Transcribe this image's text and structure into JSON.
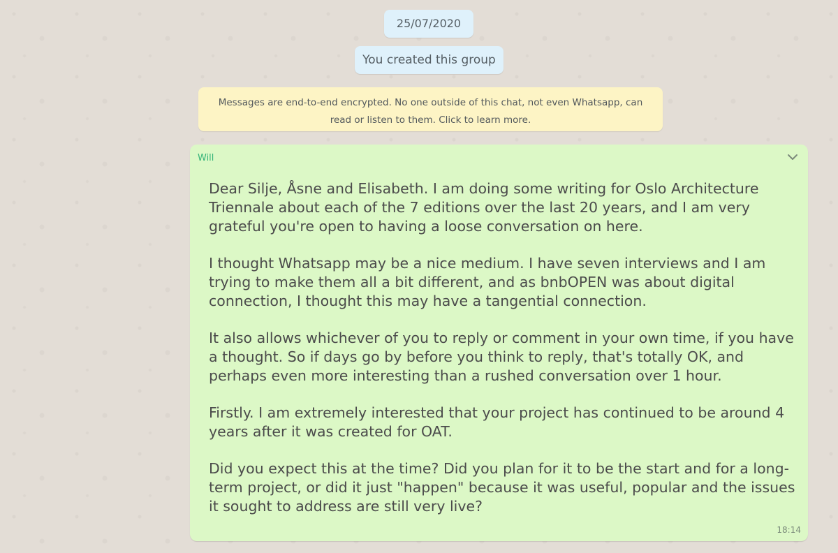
{
  "chat": {
    "date_pill": "25/07/2020",
    "system_message": "You created this group",
    "encryption_notice": {
      "line1": "Messages are end-to-end encrypted. No one outside of this chat, not even Whatsapp, can",
      "line2": "read or listen to them. Click to learn more."
    },
    "message": {
      "sender": "Will",
      "menu_icon": "chevron-down-icon",
      "paragraphs": [
        "Dear Silje, Åsne and Elisabeth. I am doing some writing for Oslo Architecture Triennale about each of the 7 editions over the last 20 years, and I am very grateful you're open to having a loose conversation on here.",
        "I thought Whatsapp may be a nice medium. I have seven interviews and I am trying to make them all a bit different, and as bnbOPEN was about digital connection, I thought this may have a tangential connection.",
        "It also allows whichever of you to reply or comment in your own time, if you have a thought. So if days go by before you think to reply, that's totally OK, and perhaps even more interesting than a rushed conversation over 1 hour.",
        "Firstly. I am extremely interested that your project has continued to be around 4 years after it was created for OAT.",
        "Did you expect this at the time? Did you plan for it to be the start and for a long-term project, or did it just \"happen\" because it was useful, popular and the issues it sought to address are still very live?"
      ],
      "time": "18:14"
    },
    "colors": {
      "background": "#e3ddd6",
      "outgoing_bubble": "#dcf8c6",
      "system_pill": "#dff1fb",
      "encryption_notice": "#fdf4c5",
      "sender_name": "#35b478"
    }
  }
}
